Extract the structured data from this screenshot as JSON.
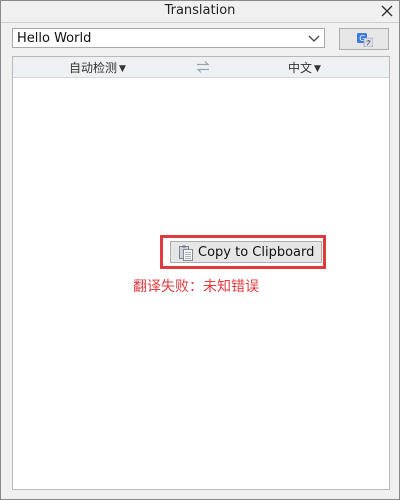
{
  "window": {
    "title": "Translation",
    "close_icon": "close-icon"
  },
  "input": {
    "value": "Hello World",
    "dropdown_icon": "chevron-down-icon"
  },
  "translate_button": {
    "icon": "google-translate-icon"
  },
  "languages": {
    "source": "自动检测",
    "target": "中文",
    "swap_icon": "swap-arrows-icon"
  },
  "result": {
    "copy_button_label": "Copy to Clipboard",
    "copy_icon": "clipboard-icon",
    "error_message": "翻译失败：未知错误"
  },
  "colors": {
    "error": "#e0393e",
    "highlight": "#e0393e",
    "accent": "#3b7be0"
  }
}
